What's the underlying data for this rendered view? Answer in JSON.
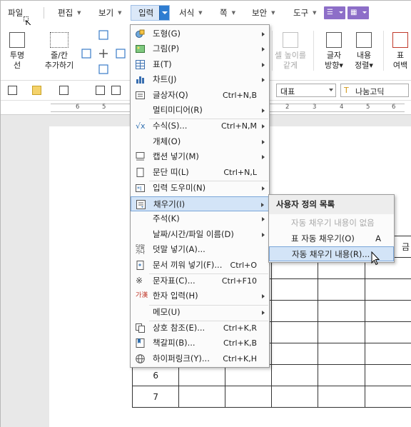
{
  "menubar": {
    "file": "파일",
    "items": [
      "편집",
      "보기",
      "입력",
      "서식",
      "쪽",
      "보안",
      "도구"
    ]
  },
  "ribbon": {
    "left": [
      {
        "label": "투명\n선"
      },
      {
        "label": "줄/칸\n추가하기"
      }
    ],
    "right": [
      {
        "label": "셀 높이를\n같게",
        "disabled": true
      },
      {
        "label": "글자\n방향▾"
      },
      {
        "label": "내용\n정렬▾"
      },
      {
        "label": "표\n여백"
      }
    ]
  },
  "toolbar": {
    "style_combo": "대표",
    "font_combo": "나눔고딕"
  },
  "ruler": {
    "left_numbers": [
      "6",
      "5"
    ],
    "right_numbers": [
      "2",
      "3",
      "4",
      "5",
      "6"
    ]
  },
  "menu": {
    "items": [
      {
        "label": "도형(G)",
        "shortcut": "",
        "arrow": true,
        "icon": "shape-icon"
      },
      {
        "label": "그림(P)",
        "shortcut": "",
        "arrow": true,
        "icon": "picture-icon"
      },
      {
        "label": "표(T)",
        "shortcut": "",
        "arrow": true,
        "icon": "table-icon"
      },
      {
        "label": "차트(J)",
        "shortcut": "",
        "arrow": true,
        "icon": "chart-icon"
      },
      {
        "label": "글상자(Q)",
        "shortcut": "Ctrl+N,B",
        "arrow": false,
        "icon": "textbox-icon"
      },
      {
        "label": "멀티미디어(R)",
        "shortcut": "",
        "arrow": true,
        "icon": ""
      },
      {
        "label": "수식(S)...",
        "shortcut": "Ctrl+N,M",
        "arrow": true,
        "icon": "formula-icon"
      },
      {
        "label": "개체(O)",
        "shortcut": "",
        "arrow": true,
        "icon": ""
      },
      {
        "label": "캡션 넣기(M)",
        "shortcut": "",
        "arrow": true,
        "icon": "caption-icon"
      },
      {
        "label": "문단 띠(L)",
        "shortcut": "Ctrl+N,L",
        "arrow": false,
        "icon": "paragraph-band-icon"
      },
      {
        "label": "입력 도우미(N)",
        "shortcut": "",
        "arrow": true,
        "icon": "input-helper-icon"
      },
      {
        "label": "채우기(I)",
        "shortcut": "",
        "arrow": true,
        "icon": "fill-icon"
      },
      {
        "label": "주석(K)",
        "shortcut": "",
        "arrow": true,
        "icon": ""
      },
      {
        "label": "날짜/시간/파일 이름(D)",
        "shortcut": "",
        "arrow": true,
        "icon": ""
      },
      {
        "label": "덧말 넣기(A)...",
        "shortcut": "",
        "arrow": false,
        "icon": "ruby-text-icon"
      },
      {
        "label": "문서 끼워 넣기(F)...",
        "shortcut": "Ctrl+O",
        "arrow": false,
        "icon": "insert-document-icon"
      },
      {
        "label": "문자표(C)...",
        "shortcut": "Ctrl+F10",
        "arrow": false,
        "icon": "symbol-icon"
      },
      {
        "label": "한자 입력(H)",
        "shortcut": "",
        "arrow": true,
        "icon": "hanja-icon"
      },
      {
        "label": "메모(U)",
        "shortcut": "",
        "arrow": true,
        "icon": ""
      },
      {
        "label": "상호 참조(E)...",
        "shortcut": "Ctrl+K,R",
        "arrow": false,
        "icon": "cross-reference-icon"
      },
      {
        "label": "책갈피(B)...",
        "shortcut": "Ctrl+K,B",
        "arrow": false,
        "icon": "bookmark-icon"
      },
      {
        "label": "하이퍼링크(Y)...",
        "shortcut": "Ctrl+K,H",
        "arrow": false,
        "icon": "hyperlink-icon"
      }
    ]
  },
  "submenu": {
    "header": "사용자 정의 목록",
    "items": [
      {
        "label": "자동 채우기 내용이 없음",
        "shortcut": "",
        "disabled": true
      },
      {
        "label": "표 자동 채우기(O)",
        "shortcut": "A",
        "disabled": false
      },
      {
        "label": "자동 채우기 내용(R)...",
        "shortcut": "",
        "disabled": false
      }
    ]
  },
  "table": {
    "header_fragment": "금",
    "row_numbers": [
      "6",
      "7"
    ]
  }
}
